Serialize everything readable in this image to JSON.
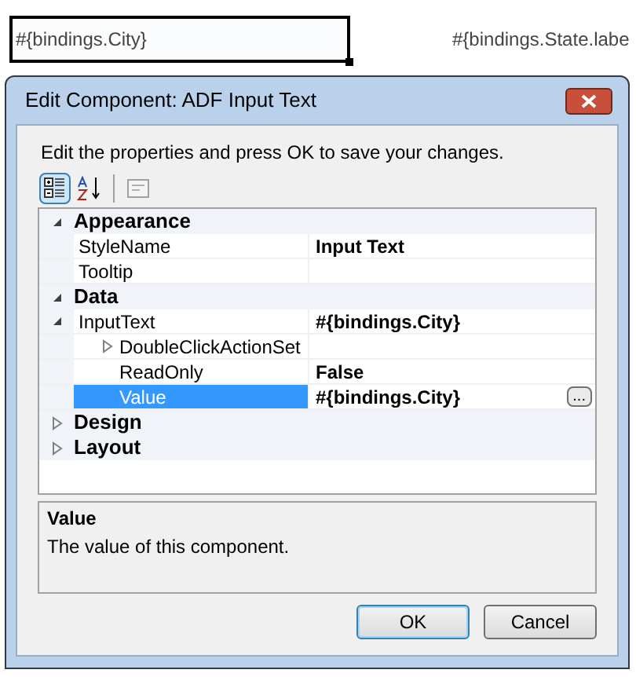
{
  "designer": {
    "field_value": "#{bindings.City}",
    "label": "#{bindings.State.labe"
  },
  "dialog": {
    "title": "Edit Component: ADF Input Text",
    "instruction": "Edit the properties and press OK to save your changes.",
    "toolbar": [
      {
        "kind": "categorized",
        "selected": true
      },
      {
        "kind": "alphabetical",
        "selected": false
      },
      {
        "kind": "pages",
        "selected": false
      }
    ],
    "categories": [
      {
        "name": "Appearance",
        "expanded": true,
        "children": [
          {
            "name": "StyleName",
            "value": "Input Text",
            "selected": false
          },
          {
            "name": "Tooltip",
            "selected": false
          }
        ]
      },
      {
        "name": "Data",
        "expanded": true,
        "children": [
          {
            "name": "InputText",
            "value": "#{bindings.City}",
            "selected": false,
            "expanded": true,
            "children": [
              {
                "name": "DoubleClickActionSet",
                "selected": false,
                "expanded": false
              },
              {
                "name": "ReadOnly",
                "value": "False",
                "selected": false
              },
              {
                "name": "Value",
                "value": "#{bindings.City}",
                "selected": true,
                "editor_button": "..."
              }
            ]
          }
        ]
      },
      {
        "name": "Design",
        "expanded": false
      },
      {
        "name": "Layout",
        "expanded": false
      }
    ],
    "description": {
      "title": "Value",
      "text": "The value of this component."
    },
    "buttons": [
      {
        "label": "OK",
        "default": true
      },
      {
        "label": "Cancel",
        "default": false
      }
    ]
  }
}
